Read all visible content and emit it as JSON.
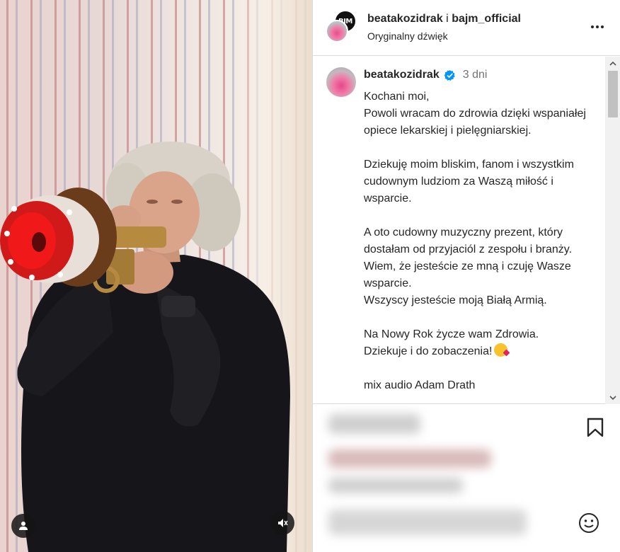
{
  "post": {
    "author_primary": "beatakozidrak",
    "connector": "i",
    "author_secondary": "bajm_official",
    "audio_label": "Oryginalny dźwięk",
    "secondary_avatar_text": "BJM"
  },
  "caption": {
    "username": "beatakozidrak",
    "time": "3 dni",
    "paragraphs": [
      "Kochani moi,\nPowoli wracam do zdrowia dzięki wspaniałej opiece lekarskiej i pielęgniarskiej.",
      "Dziekuję moim bliskim, fanom i wszystkim cudownym ludziom za Waszą miłość i wsparcie.",
      "A oto cudowny muzyczny prezent, który dostałam od przyjaciól z zespołu i branży. Wiem, że jesteście ze mną i czuję Wasze wsparcie.\nWszyscy jesteście moją Białą Armią.",
      "Na Nowy Rok życze wam Zdrowia.\nDziekuje i do zobaczenia!",
      "mix audio Adam Drath"
    ]
  },
  "icons": {
    "more": "more-options-icon",
    "verified": "verified-badge-icon",
    "bookmark": "bookmark-icon",
    "emoji": "emoji-smiley-icon",
    "tag": "person-tag-icon",
    "mute": "muted-speaker-icon"
  },
  "colors": {
    "verified": "#0095f6",
    "text": "#262626",
    "secondary_text": "#737373",
    "border": "#dbdbdb"
  }
}
